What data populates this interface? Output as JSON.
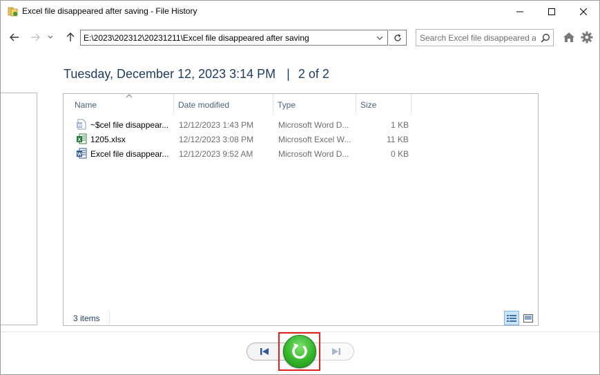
{
  "window": {
    "title": "Excel file disappeared after saving - File History"
  },
  "nav": {
    "address": "E:\\2023\\202312\\20231211\\Excel file disappeared after saving",
    "search_placeholder": "Search Excel file disappeared a..."
  },
  "snapshot": {
    "date": "Tuesday, December 12, 2023 3:14 PM",
    "separator": "|",
    "position": "2 of 2"
  },
  "columns": {
    "name": "Name",
    "date_modified": "Date modified",
    "type": "Type",
    "size": "Size"
  },
  "files": [
    {
      "name": "~$cel file disappear...",
      "date": "12/12/2023 1:43 PM",
      "type": "Microsoft Word D...",
      "size": "1 KB",
      "icon": "word-temp-icon"
    },
    {
      "name": "1205.xlsx",
      "date": "12/12/2023 3:08 PM",
      "type": "Microsoft Excel W...",
      "size": "11 KB",
      "icon": "excel-icon"
    },
    {
      "name": "Excel file disappear...",
      "date": "12/12/2023 9:52 AM",
      "type": "Microsoft Word D...",
      "size": "0 KB",
      "icon": "word-icon"
    }
  ],
  "status": {
    "item_count": "3 items"
  },
  "colors": {
    "heading": "#1e3a5c",
    "restore_green": "#35b52b",
    "highlight_red": "#e3201b",
    "selected_view": "#cce4f7"
  }
}
